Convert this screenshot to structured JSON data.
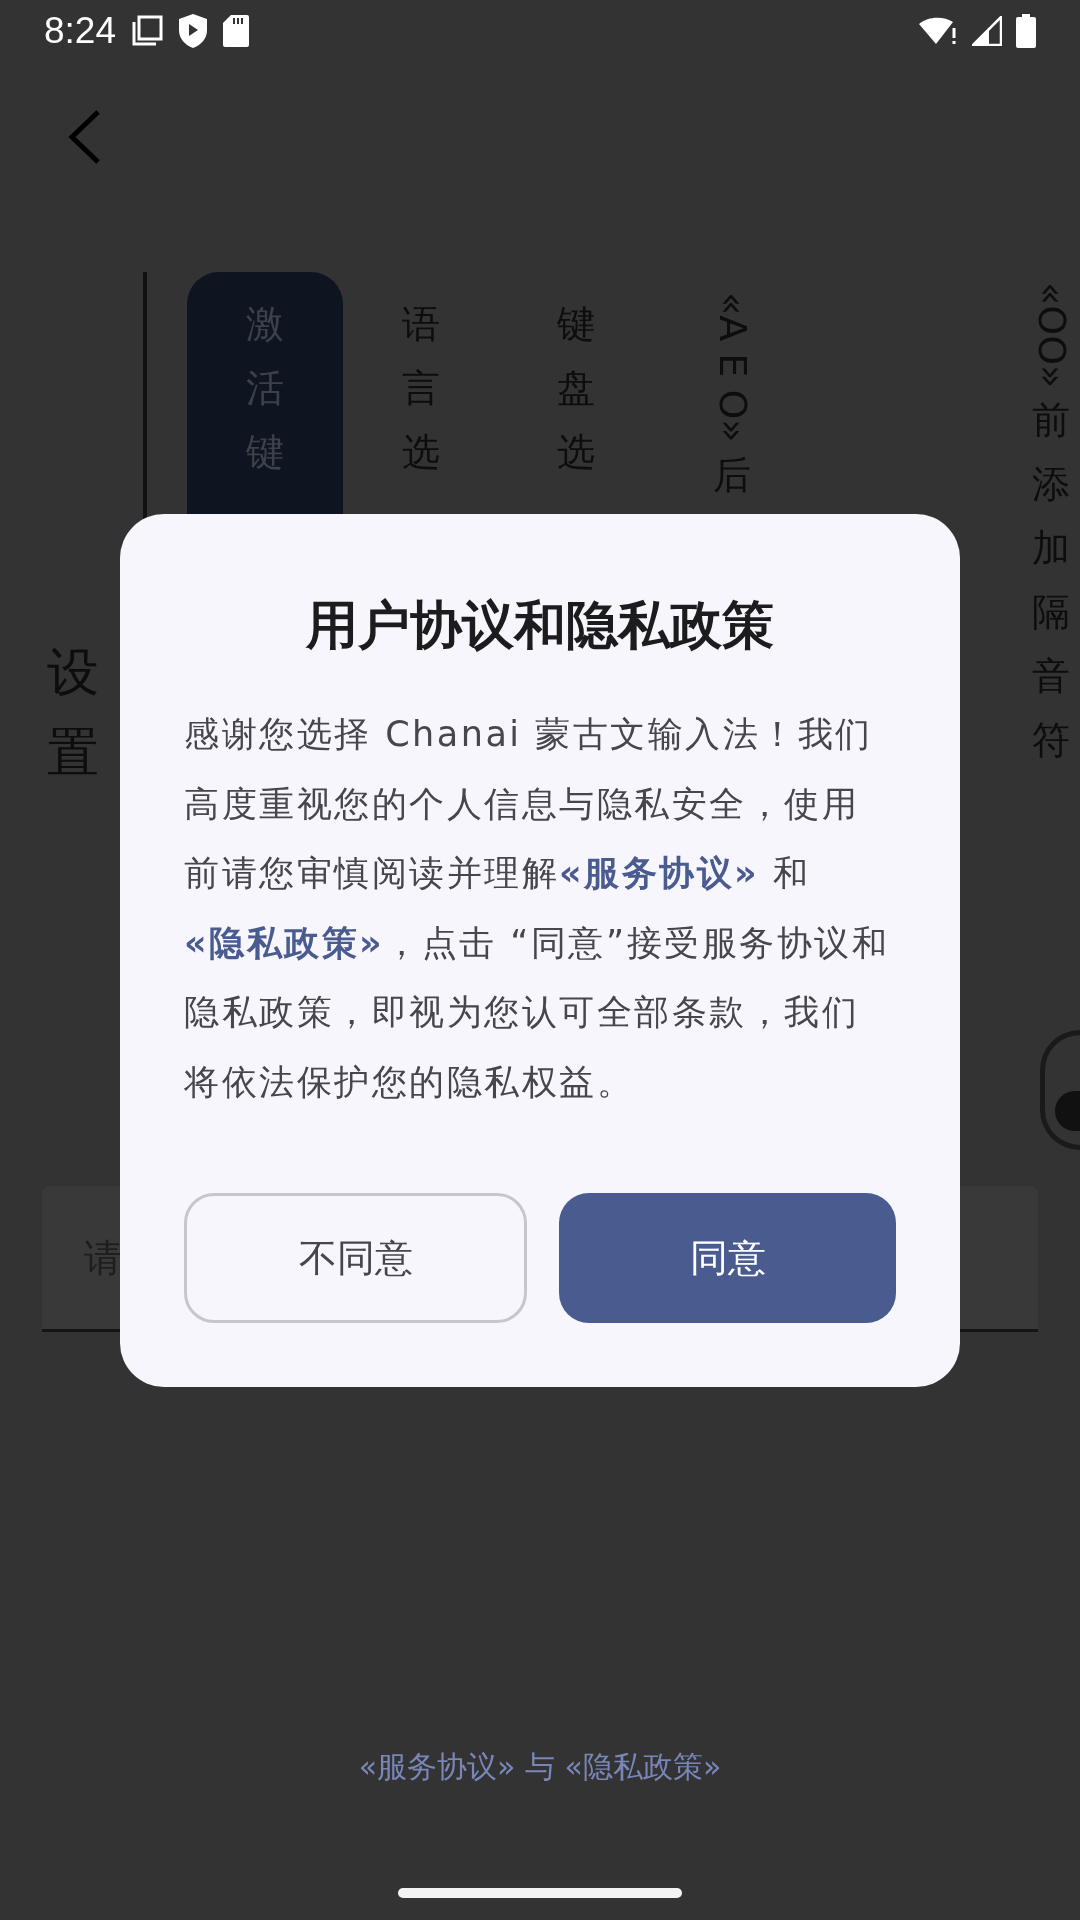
{
  "status_bar": {
    "time": "8:24"
  },
  "side_title": "设置",
  "tabs": [
    {
      "label": "激活键",
      "selected": true
    },
    {
      "label": "语言选",
      "selected": false
    },
    {
      "label": "键盘选",
      "selected": false
    },
    {
      "label": "«A E O»后",
      "selected": false
    }
  ],
  "side_column": "«OO»前添加隔音符",
  "switch": {
    "on": false
  },
  "field": {
    "placeholder": "请"
  },
  "dialog": {
    "title": "用户协议和隐私政策",
    "body": [
      {
        "kind": "text",
        "text": "感谢您选择 Chanai 蒙古文输入法！我们高度重视您的个人信息与隐私安全，使用前请您审慎阅读并理解"
      },
      {
        "kind": "link",
        "text": "«服务协议»"
      },
      {
        "kind": "text",
        "text": " 和 "
      },
      {
        "kind": "link",
        "text": "«隐私政策»"
      },
      {
        "kind": "text",
        "text": "，点击 “同意”接受服务协议和隐私政策，即视为您认可全部条款，我们将依法保护您的隐私权益。"
      }
    ],
    "buttons": [
      {
        "label": "不同意",
        "kind": "secondary"
      },
      {
        "label": "同意",
        "kind": "primary"
      }
    ]
  },
  "footer_links": "«服务协议» 与 «隐私政策»"
}
